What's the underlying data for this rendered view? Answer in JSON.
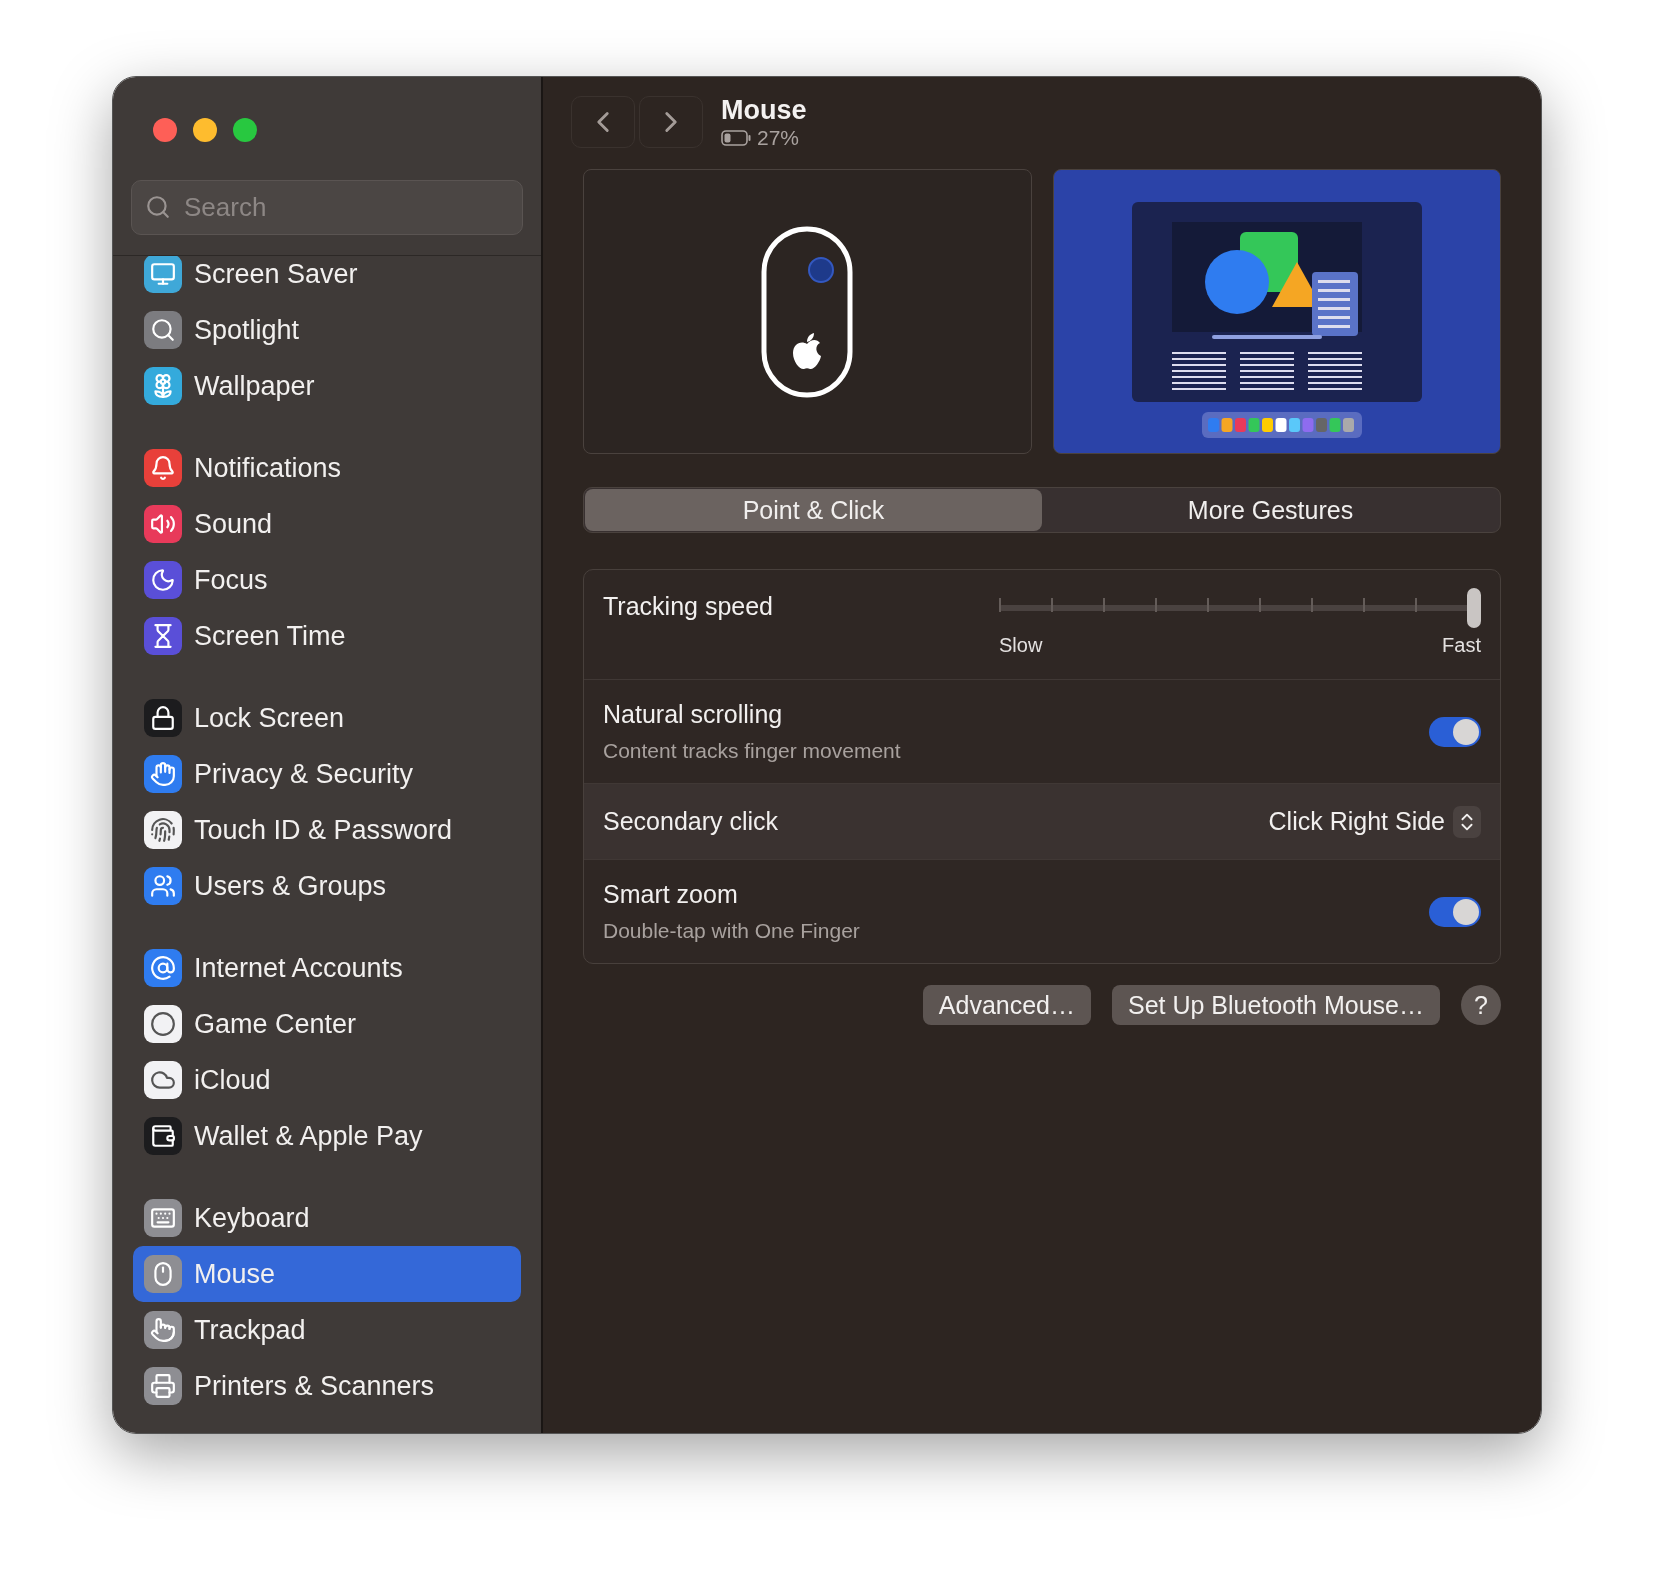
{
  "sidebar": {
    "search": {
      "placeholder": "Search"
    },
    "groups": [
      {
        "items": [
          {
            "label": "Screen Saver",
            "kind": "monitor",
            "color": "#3fa8d8",
            "selected": false
          },
          {
            "label": "Spotlight",
            "kind": "search",
            "color": "#7c7c80",
            "selected": false
          },
          {
            "label": "Wallpaper",
            "kind": "flower",
            "color": "#34aadc",
            "selected": false
          }
        ]
      },
      {
        "items": [
          {
            "label": "Notifications",
            "kind": "bell",
            "color": "#e8403a",
            "selected": false
          },
          {
            "label": "Sound",
            "kind": "speaker",
            "color": "#e83a5a",
            "selected": false
          },
          {
            "label": "Focus",
            "kind": "moon",
            "color": "#5a4fd8",
            "selected": false
          },
          {
            "label": "Screen Time",
            "kind": "hourglass",
            "color": "#5a4fd8",
            "selected": false
          }
        ]
      },
      {
        "items": [
          {
            "label": "Lock Screen",
            "kind": "lock",
            "color": "#1c1c1e",
            "selected": false
          },
          {
            "label": "Privacy & Security",
            "kind": "hand",
            "color": "#2f7cf0",
            "selected": false
          },
          {
            "label": "Touch ID & Password",
            "kind": "fingerprint",
            "color": "#f2f2f4",
            "selected": false
          },
          {
            "label": "Users & Groups",
            "kind": "users",
            "color": "#2f7cf0",
            "selected": false
          }
        ]
      },
      {
        "items": [
          {
            "label": "Internet Accounts",
            "kind": "at",
            "color": "#2f7cf0",
            "selected": false
          },
          {
            "label": "Game Center",
            "kind": "circles",
            "color": "#f2f2f4",
            "selected": false
          },
          {
            "label": "iCloud",
            "kind": "cloud",
            "color": "#f2f2f4",
            "selected": false
          },
          {
            "label": "Wallet & Apple Pay",
            "kind": "wallet",
            "color": "#1c1c1e",
            "selected": false
          }
        ]
      },
      {
        "items": [
          {
            "label": "Keyboard",
            "kind": "keyboard",
            "color": "#8e8e93",
            "selected": false
          },
          {
            "label": "Mouse",
            "kind": "mouse",
            "color": "#8e8e93",
            "selected": true
          },
          {
            "label": "Trackpad",
            "kind": "pointer",
            "color": "#8e8e93",
            "selected": false
          },
          {
            "label": "Printers & Scanners",
            "kind": "printer",
            "color": "#8e8e93",
            "selected": false
          }
        ]
      }
    ]
  },
  "toolbar": {
    "title": "Mouse",
    "battery": "27%"
  },
  "tabs": [
    {
      "label": "Point & Click",
      "selected": true
    },
    {
      "label": "More Gestures",
      "selected": false
    }
  ],
  "settings": [
    {
      "kind": "slider",
      "title": "Tracking speed",
      "level": 1,
      "min_label": "Slow",
      "max_label": "Fast",
      "highlighted": false
    },
    {
      "kind": "toggle",
      "title": "Natural scrolling",
      "subtitle": "Content tracks finger movement",
      "on": true,
      "highlighted": false
    },
    {
      "kind": "popup",
      "title": "Secondary click",
      "value": "Click Right Side",
      "highlighted": true
    },
    {
      "kind": "toggle",
      "title": "Smart zoom",
      "subtitle": "Double-tap with One Finger",
      "on": true,
      "highlighted": false
    }
  ],
  "buttons": [
    "Advanced…",
    "Set Up Bluetooth Mouse…"
  ],
  "help": "?"
}
